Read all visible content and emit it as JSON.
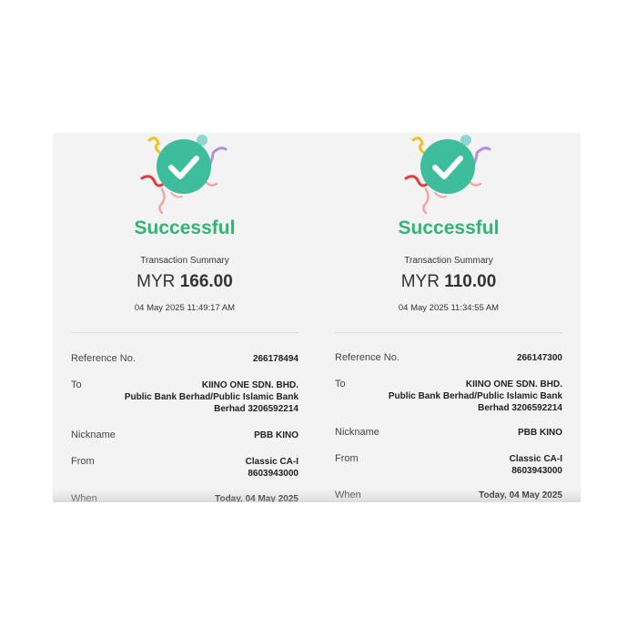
{
  "receipts": [
    {
      "status": "Successful",
      "summary_title": "Transaction Summary",
      "currency": "MYR",
      "amount": "166.00",
      "datetime": "04 May 2025 11:49:17 AM",
      "reference_label": "Reference No.",
      "reference_value": "266178494",
      "to_label": "To",
      "to_line1": "KIINO ONE SDN. BHD.",
      "to_line2": "Public Bank Berhad/Public Islamic Bank",
      "to_line3": "Berhad 3206592214",
      "nickname_label": "Nickname",
      "nickname_value": "PBB KINO",
      "from_label": "From",
      "from_line1": "Classic  CA-I",
      "from_line2": "8603943000",
      "when_label": "When",
      "when_value": "Today, 04 May 2025"
    },
    {
      "status": "Successful",
      "summary_title": "Transaction Summary",
      "currency": "MYR",
      "amount": "110.00",
      "datetime": "04 May 2025 11:34:55 AM",
      "reference_label": "Reference No.",
      "reference_value": "266147300",
      "to_label": "To",
      "to_line1": "KIINO ONE SDN. BHD.",
      "to_line2": "Public Bank Berhad/Public Islamic Bank",
      "to_line3": "Berhad 3206592214",
      "nickname_label": "Nickname",
      "nickname_value": "PBB KINO",
      "from_label": "From",
      "from_line1": "Classic  CA-I",
      "from_line2": "8603943000",
      "when_label": "When",
      "when_value": "Today, 04 May 2025"
    }
  ],
  "colors": {
    "success_green": "#2fb574",
    "check_circle": "#3dbd9c",
    "panel_bg": "#f3f3f3"
  },
  "icons": {
    "status_icon": "success-check-icon",
    "decoration": "confetti-icon"
  }
}
